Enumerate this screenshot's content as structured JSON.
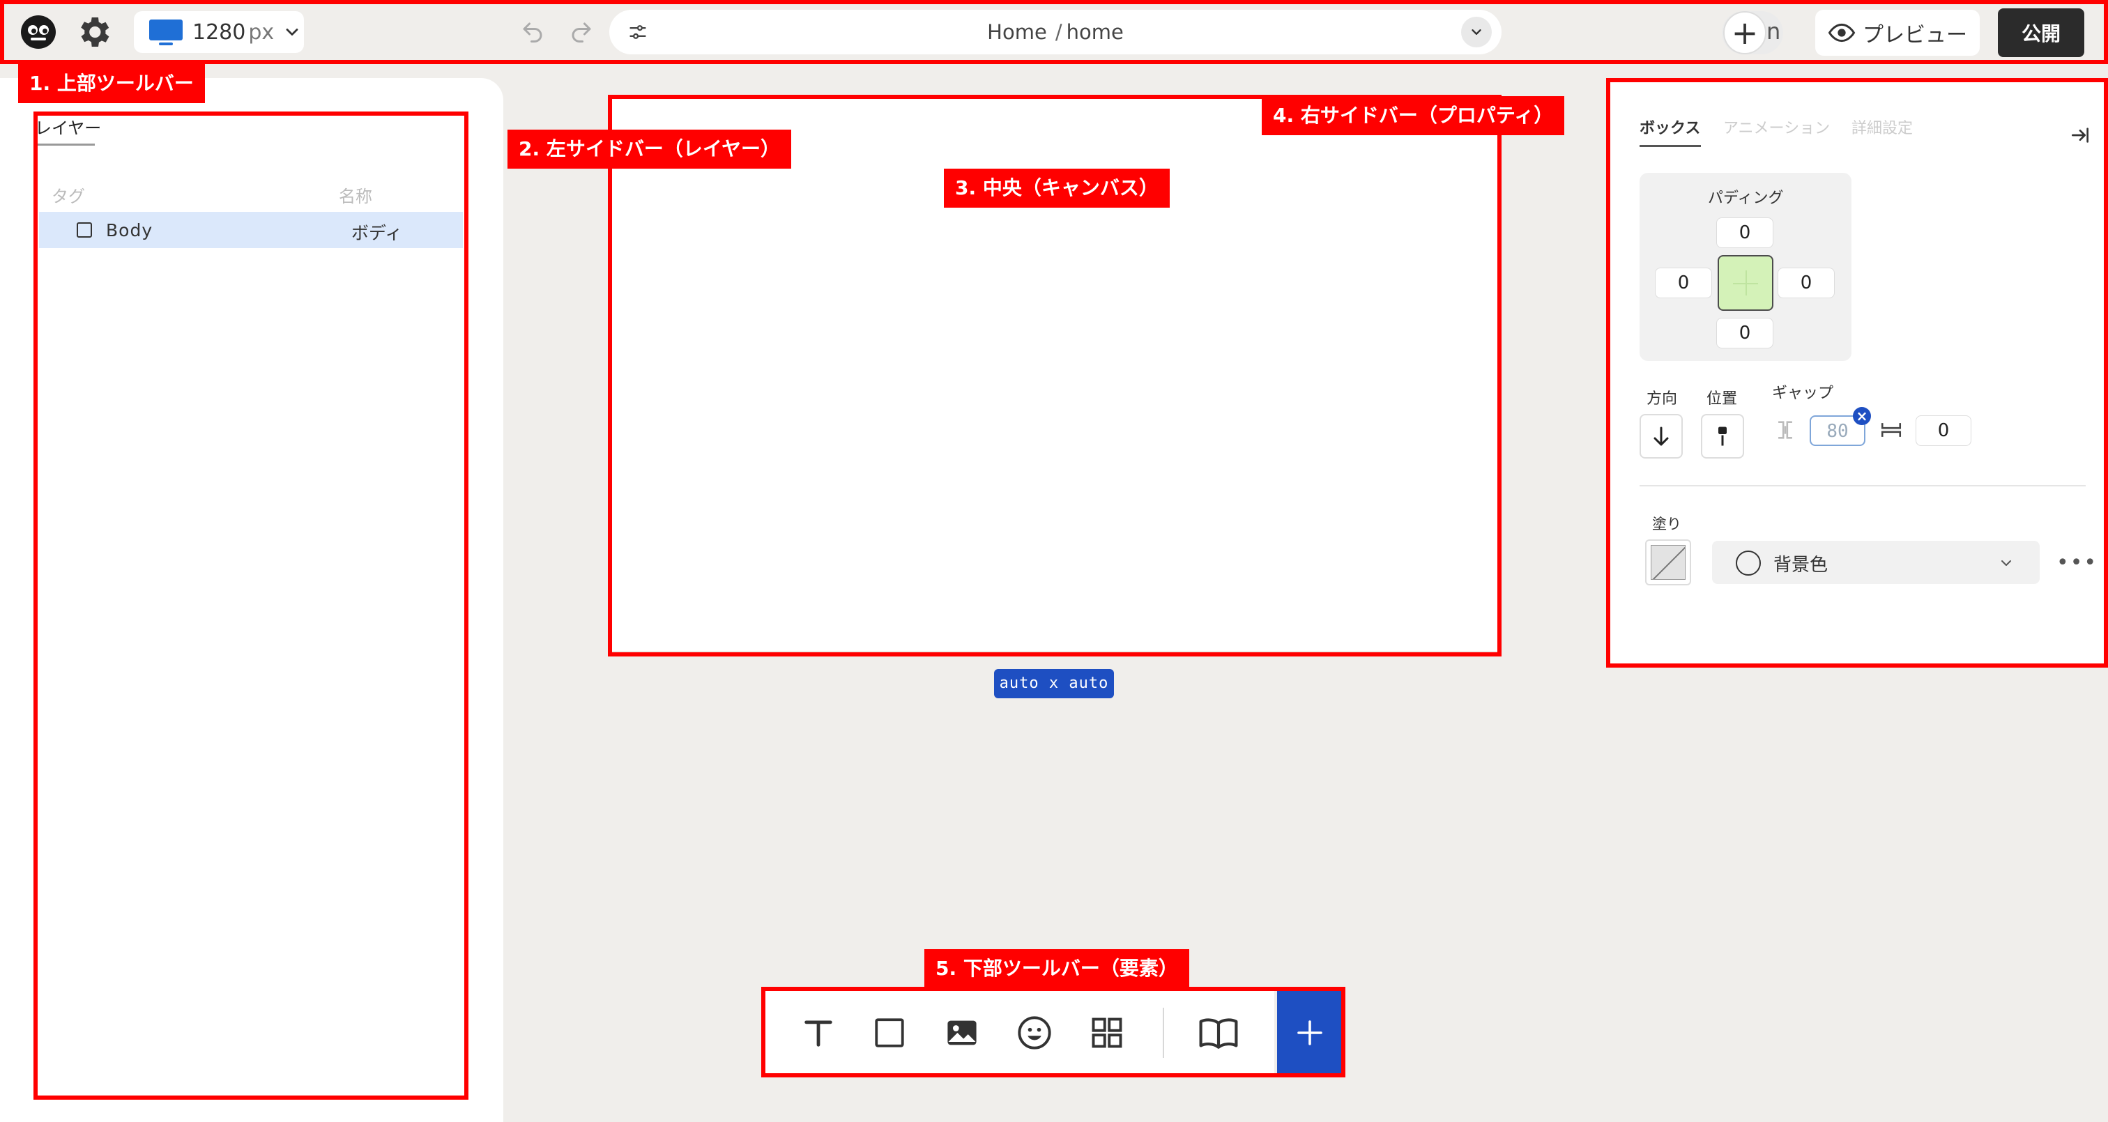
{
  "topbar": {
    "viewport_value": "1280",
    "viewport_unit": "px",
    "path_root": "Home",
    "path_separator": "/",
    "path_page": "home",
    "add_trailing_char": "n",
    "add_symbol": "+",
    "preview_label": "プレビュー",
    "publish_label": "公開"
  },
  "left_panel": {
    "tab_label": "レイヤー",
    "column_tag": "タグ",
    "column_name": "名称",
    "layers": [
      {
        "tag": "Body",
        "name": "ボディ",
        "selected": true
      }
    ]
  },
  "canvas": {
    "size_badge": "auto x auto"
  },
  "right_panel": {
    "tabs": [
      {
        "label": "ボックス",
        "active": true
      },
      {
        "label": "アニメーション",
        "active": false
      },
      {
        "label": "詳細設定",
        "active": false
      }
    ],
    "padding": {
      "title": "パディング",
      "top": "0",
      "left": "0",
      "right": "0",
      "bottom": "0"
    },
    "direction_label": "方向",
    "position_label": "位置",
    "gap_label": "ギャップ",
    "gap_vertical_placeholder": "80",
    "gap_horizontal": "0",
    "fill_label": "塗り",
    "fill_select": "背景色",
    "more": "•••"
  },
  "bottom_toolbar": {
    "add_symbol": "+"
  },
  "annotations": [
    {
      "label": "1. 上部ツールバー"
    },
    {
      "label": "2. 左サイドバー（レイヤー）"
    },
    {
      "label": "3. 中央（キャンバス）"
    },
    {
      "label": "4. 右サイドバー（プロパティ）"
    },
    {
      "label": "5. 下部ツールバー（要素）"
    }
  ],
  "colors": {
    "background": "#f0eeeb",
    "accent_blue": "#1e4fc2",
    "annotation_red": "#ff0000",
    "selected_row": "#dbe8fb",
    "padding_center": "#d4f2b8",
    "publish_button": "#2b2b2b"
  },
  "icons": [
    "app-logo-icon",
    "gear-icon",
    "monitor-icon",
    "chevron-down-icon",
    "undo-icon",
    "redo-icon",
    "filter-icon",
    "plus-icon",
    "eye-icon",
    "square-icon",
    "collapse-panel-icon",
    "arrow-down-icon",
    "align-top-icon",
    "gap-vertical-icon",
    "gap-horizontal-icon",
    "close-icon",
    "circle-icon",
    "text-icon",
    "image-icon",
    "emoji-icon",
    "grid-icon",
    "book-icon"
  ]
}
